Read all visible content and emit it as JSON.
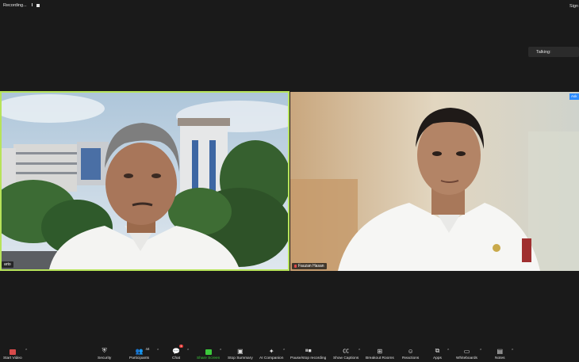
{
  "top": {
    "recording_label": "Recording...",
    "pause_glyph": "II",
    "sign_label": "Sign"
  },
  "talking_label": "Talking:",
  "participants": [
    {
      "name": "arto",
      "muted": false
    },
    {
      "name": "Fauzan Hasan",
      "muted": true
    }
  ],
  "ask_badge": "Ask",
  "toolbar": {
    "start_video": "Start Video",
    "security": "Security",
    "participants": "Participants",
    "participants_count": "44",
    "chat": "Chat",
    "chat_badge": "1",
    "share_screen": "Share Screen",
    "stop_summary": "Stop Summary",
    "ai_companion": "AI Companion",
    "pause_stop_recording": "Pause/stop recording",
    "show_captions": "Show Captions",
    "breakout_rooms": "Breakout Rooms",
    "reactions": "Reactions",
    "apps": "Apps",
    "whiteboards": "Whiteboards",
    "notes": "Notes"
  },
  "colors": {
    "active_speaker_border": "#b7e35a",
    "share_green": "#3cc93c",
    "badge_red": "#e53935",
    "accent_blue": "#2d8cff",
    "background": "#1a1a1a"
  }
}
